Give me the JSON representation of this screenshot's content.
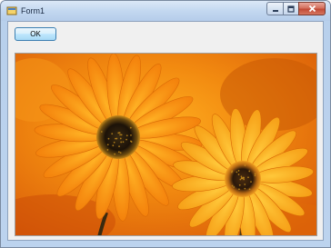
{
  "window": {
    "title": "Form1"
  },
  "form": {
    "ok_button_label": "OK"
  },
  "image": {
    "icon": "orange-daisy-flowers-photo"
  },
  "colors": {
    "titlebar": "#c3d8f0",
    "client_background": "#f0f0f0",
    "button_border": "#3c7fb1",
    "petal_orange": "#ff9a10",
    "flower_center": "#2a1a08",
    "background_orange": "#e87a10"
  }
}
